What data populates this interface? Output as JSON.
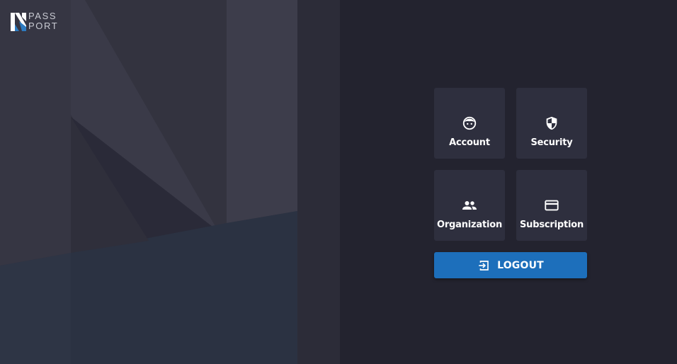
{
  "brand": {
    "logo_letter": "N",
    "logo_line1": "PASS",
    "logo_line2": "PORT"
  },
  "tiles": [
    {
      "label": "Account",
      "icon": "face-icon"
    },
    {
      "label": "Security",
      "icon": "shield-icon"
    },
    {
      "label": "Organization",
      "icon": "people-icon"
    },
    {
      "label": "Subscription",
      "icon": "credit-card-icon"
    }
  ],
  "logout": {
    "label": "LOGOUT",
    "icon": "logout-icon"
  },
  "colors": {
    "left_background": "#2f2f3c",
    "right_background": "#23232f",
    "tile_background": "#2e2f3e",
    "button_primary": "#1d6fbb",
    "logo_accent": "#2d7bc0"
  }
}
